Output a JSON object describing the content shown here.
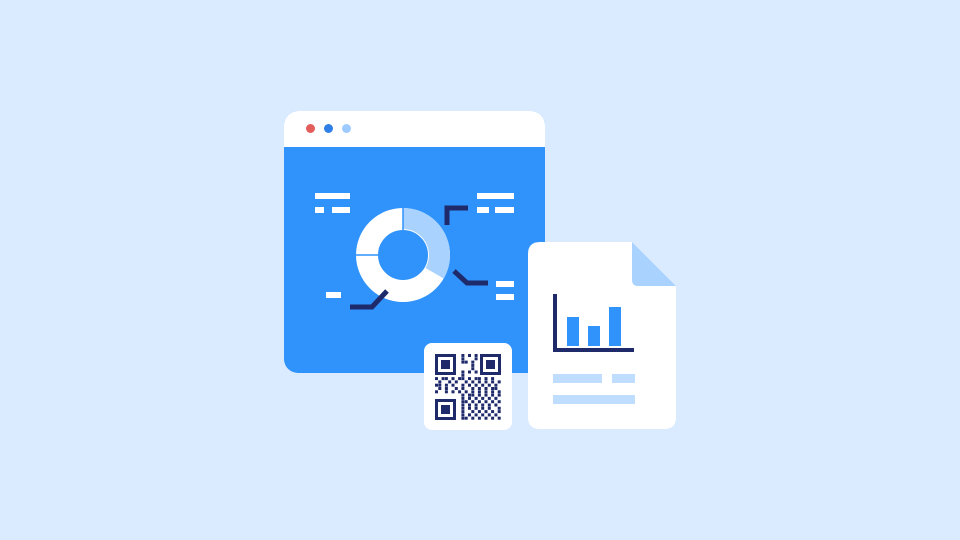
{
  "colors": {
    "background": "#daeaff",
    "window_blue": "#2f93fb",
    "window_bar": "#ffffff",
    "dot_red": "#e35d5b",
    "dot_blue": "#2f7fe6",
    "dot_lightblue": "#9ecbff",
    "navy": "#1f2a6b",
    "light_blue": "#a9d2ff",
    "white": "#ffffff"
  },
  "browser": {
    "controls": [
      "window-dot-red",
      "window-dot-blue",
      "window-dot-lightblue"
    ],
    "content": "donut-chart-with-callouts"
  },
  "donut_chart": {
    "segments": [
      {
        "name": "white-segment",
        "color": "#ffffff"
      },
      {
        "name": "light-segment",
        "color": "#a9d2ff"
      }
    ]
  },
  "document": {
    "icon": "bar-chart-report-icon",
    "bar_levels": [
      0.6,
      0.42,
      0.82
    ]
  },
  "qr": {
    "icon": "qr-code-icon"
  }
}
